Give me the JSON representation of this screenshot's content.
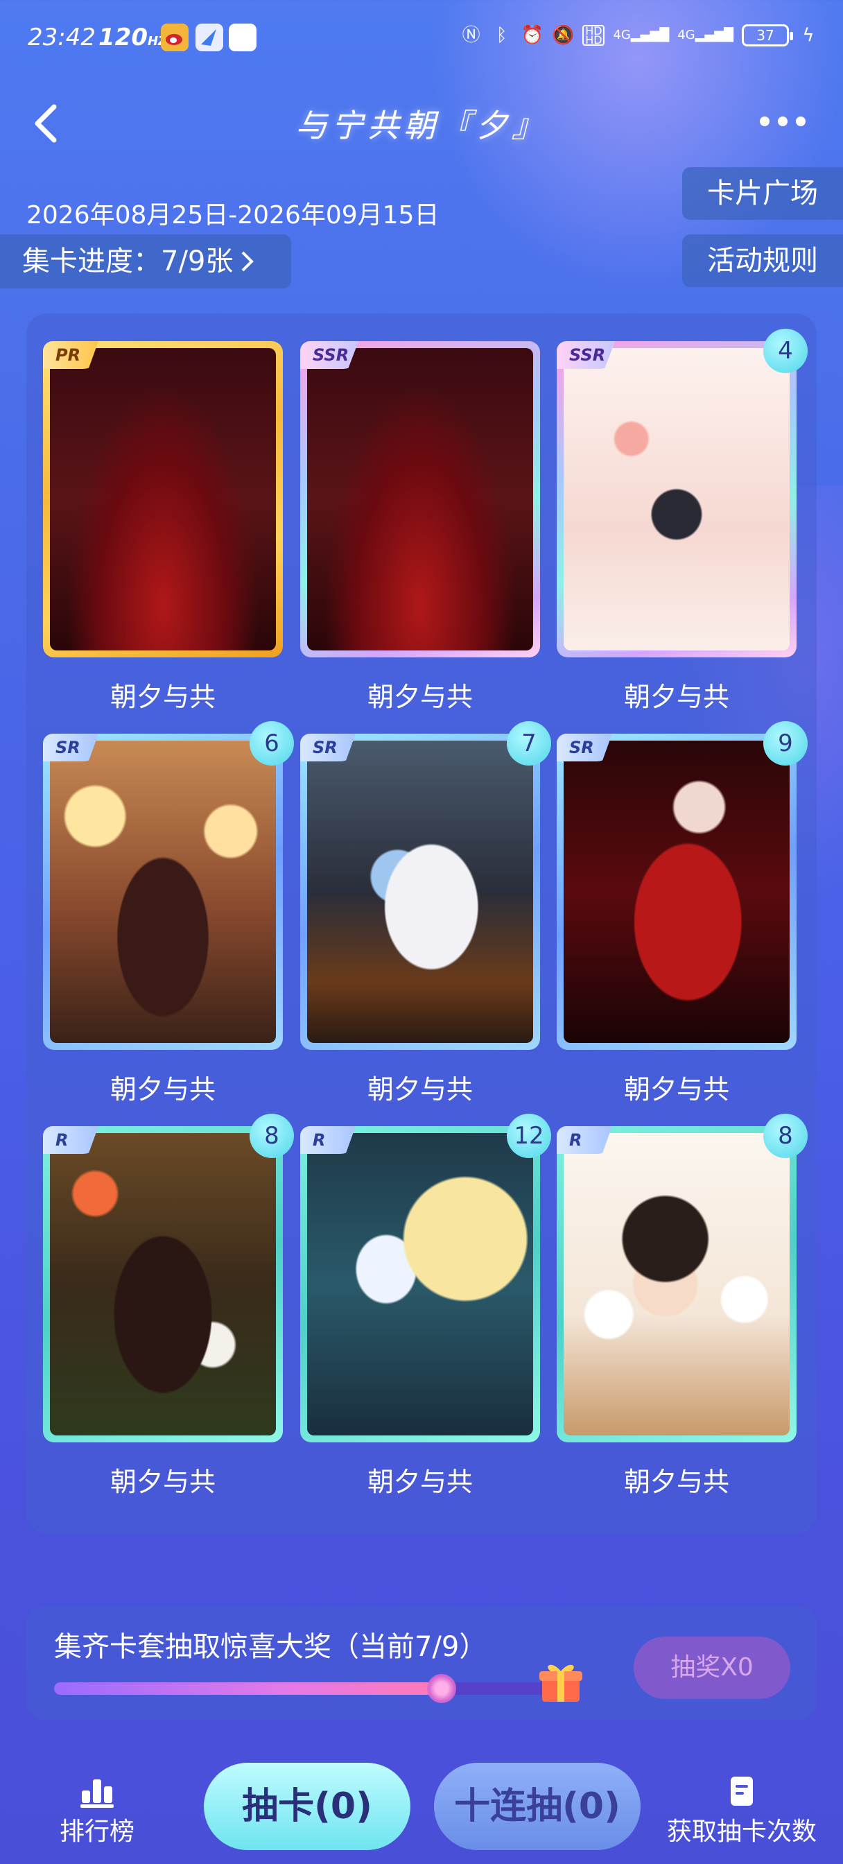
{
  "status_bar": {
    "time": "23:42",
    "refresh_rate": "120",
    "refresh_unit": "HZ",
    "battery": "37",
    "network_1": "4G",
    "network_2": "4G"
  },
  "header": {
    "title": "与宁共朝『夕』"
  },
  "event": {
    "date_range": "2026年08月25日-2026年09月15日",
    "progress_label": "集卡进度：7/9张",
    "card_plaza": "卡片广场",
    "rules": "活动规则"
  },
  "cards": [
    {
      "rarity": "PR",
      "frame": "pr",
      "count": "",
      "name": "朝夕与共",
      "art": "violinist-red-roses"
    },
    {
      "rarity": "SSR",
      "frame": "ssr",
      "count": "",
      "name": "朝夕与共",
      "art": "violinist-red-roses"
    },
    {
      "rarity": "SSR",
      "frame": "ssr",
      "count": "4",
      "name": "朝夕与共",
      "art": "kneeling-petals"
    },
    {
      "rarity": "SR",
      "frame": "sr",
      "count": "6",
      "name": "朝夕与共",
      "art": "lanterns-calligraphy"
    },
    {
      "rarity": "SR",
      "frame": "sr",
      "count": "7",
      "name": "朝夕与共",
      "art": "white-suit-bouquet"
    },
    {
      "rarity": "SR",
      "frame": "sr",
      "count": "9",
      "name": "朝夕与共",
      "art": "red-suit-hat"
    },
    {
      "rarity": "R",
      "frame": "r",
      "count": "8",
      "name": "朝夕与共",
      "art": "dark-robe-mask"
    },
    {
      "rarity": "R",
      "frame": "r",
      "count": "12",
      "name": "朝夕与共",
      "art": "chibi-moon"
    },
    {
      "rarity": "R",
      "frame": "r",
      "count": "8",
      "name": "朝夕与共",
      "art": "smiling-cats"
    }
  ],
  "prize": {
    "text": "集齐卡套抽取惊喜大奖（当前7/9）",
    "progress": 0.778,
    "draw_button": "抽奖X0"
  },
  "bottom": {
    "leaderboard": "排行榜",
    "draw": "抽卡(0)",
    "ten_draw": "十连抽(0)",
    "get_chances": "获取抽卡次数"
  }
}
